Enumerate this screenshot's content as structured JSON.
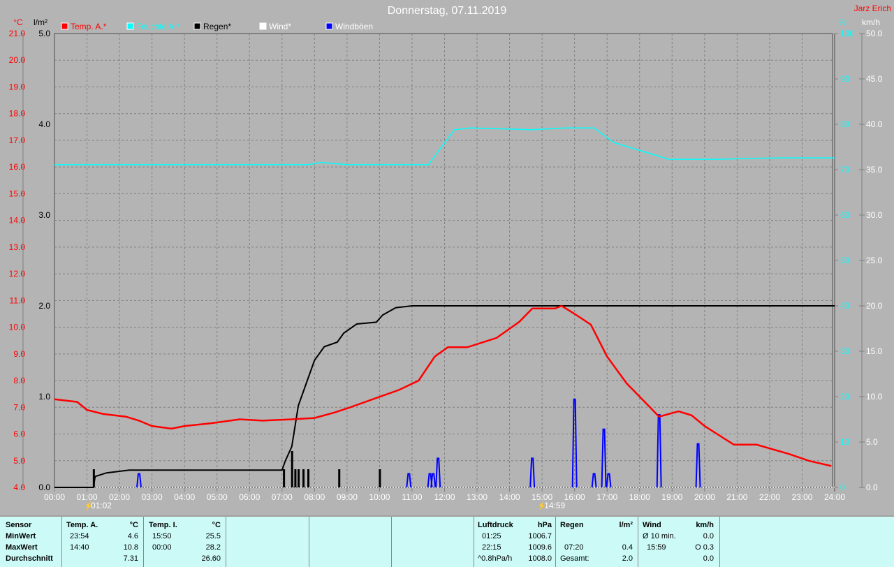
{
  "header": {
    "title": "Donnerstag, 07.11.2019",
    "author": "Jarz Erich"
  },
  "colors": {
    "temp": "#ff0000",
    "humidity": "#00ffff",
    "rain": "#000000",
    "wind": "#ffffff",
    "gusts": "#0000ff",
    "background": "#b4b4b4",
    "table": "#ccfaf7"
  },
  "chart_data": {
    "type": "line",
    "title": "Donnerstag, 07.11.2019",
    "legend": [
      "Temp. A.*",
      "Feuchte A.*",
      "Regen*",
      "Wind*",
      "Windböen"
    ],
    "legend_placement": "top",
    "grid": true,
    "x_ticks": [
      "00:00",
      "01:00",
      "02:00",
      "03:00",
      "04:00",
      "05:00",
      "06:00",
      "07:00",
      "08:00",
      "09:00",
      "10:00",
      "11:00",
      "12:00",
      "13:00",
      "14:00",
      "15:00",
      "16:00",
      "17:00",
      "18:00",
      "19:00",
      "20:00",
      "21:00",
      "22:00",
      "23:00",
      "24:00"
    ],
    "xlim": [
      0,
      24
    ],
    "axes": {
      "temp": {
        "unit": "°C",
        "ylim": [
          4,
          21
        ],
        "ticks": [
          "4.0",
          "5.0",
          "6.0",
          "7.0",
          "8.0",
          "9.0",
          "10.0",
          "11.0",
          "12.0",
          "13.0",
          "14.0",
          "15.0",
          "16.0",
          "17.0",
          "18.0",
          "19.0",
          "20.0",
          "21.0"
        ]
      },
      "rain": {
        "unit": "l/m²",
        "ylim": [
          0,
          5
        ],
        "ticks": [
          "0.0",
          "1.0",
          "2.0",
          "3.0",
          "4.0",
          "5.0"
        ]
      },
      "humidity": {
        "unit": "%",
        "ylim": [
          0,
          100
        ],
        "ticks": [
          "0",
          "10",
          "20",
          "30",
          "40",
          "50",
          "60",
          "70",
          "80",
          "90",
          "100"
        ]
      },
      "wind": {
        "unit": "km/h",
        "ylim": [
          0,
          50
        ],
        "ticks": [
          "0.0",
          "5.0",
          "10.0",
          "15.0",
          "20.0",
          "25.0",
          "30.0",
          "35.0",
          "40.0",
          "45.0",
          "50.0"
        ]
      }
    },
    "series": [
      {
        "name": "Temp. A.*",
        "axis": "temp",
        "x": [
          0,
          0.7,
          1,
          1.5,
          2.2,
          2.6,
          3,
          3.6,
          4,
          4.8,
          5.7,
          6.4,
          7.3,
          8,
          8.6,
          9.1,
          9.9,
          10.6,
          11.2,
          11.7,
          12.1,
          12.7,
          13.6,
          14.3,
          14.7,
          15.4,
          15.6,
          16,
          16.5,
          17,
          17.6,
          18.2,
          18.6,
          19.2,
          19.6,
          20,
          20.9,
          21.6,
          22.6,
          23.2,
          23.9
        ],
        "y": [
          7.3,
          7.2,
          6.9,
          6.75,
          6.65,
          6.5,
          6.3,
          6.2,
          6.3,
          6.4,
          6.55,
          6.5,
          6.55,
          6.6,
          6.8,
          7.0,
          7.35,
          7.65,
          8.0,
          8.9,
          9.25,
          9.25,
          9.6,
          10.2,
          10.7,
          10.7,
          10.8,
          10.5,
          10.1,
          8.9,
          7.9,
          7.15,
          6.65,
          6.85,
          6.7,
          6.3,
          5.6,
          5.6,
          5.25,
          5.0,
          4.8
        ]
      },
      {
        "name": "Feuchte A.*",
        "axis": "humidity",
        "x": [
          0,
          7.8,
          8.2,
          9,
          11.5,
          12.3,
          12.8,
          14.7,
          15.7,
          16.6,
          17.2,
          18.9,
          20.4,
          21.5,
          22.5,
          24
        ],
        "y": [
          71.1,
          71.1,
          71.6,
          71.1,
          71.1,
          78.8,
          79.2,
          78.8,
          79.2,
          79.2,
          76,
          72.3,
          72.3,
          72.5,
          72.6,
          72.6
        ]
      },
      {
        "name": "Regen*",
        "axis": "rain",
        "x": [
          0,
          1.2,
          1.25,
          1.6,
          2.3,
          7.0,
          7.1,
          7.3,
          7.5,
          7.8,
          8.0,
          8.3,
          8.7,
          8.9,
          9.3,
          9.9,
          10.1,
          10.5,
          11.0,
          24
        ],
        "y": [
          0,
          0,
          0.12,
          0.16,
          0.19,
          0.19,
          0.29,
          0.45,
          0.9,
          1.2,
          1.4,
          1.55,
          1.6,
          1.7,
          1.8,
          1.82,
          1.9,
          1.98,
          2.0,
          2.0
        ]
      },
      {
        "name": "Regen bars",
        "axis": "rain",
        "x": [
          1.2,
          7.05,
          7.3,
          7.4,
          7.5,
          7.65,
          7.8,
          8.75,
          10.0
        ],
        "y": [
          0.2,
          0.2,
          0.4,
          0.2,
          0.2,
          0.2,
          0.2,
          0.2,
          0.2
        ]
      },
      {
        "name": "Wind*",
        "axis": "wind",
        "x": [
          0,
          24
        ],
        "y": [
          0,
          0
        ]
      },
      {
        "name": "Windböen",
        "axis": "wind",
        "x": [
          2.6,
          10.9,
          11.55,
          11.65,
          11.8,
          14.7,
          16.0,
          16.6,
          16.9,
          17.05,
          18.6,
          19.8
        ],
        "y": [
          1.5,
          1.5,
          1.5,
          1.5,
          3.2,
          3.2,
          9.7,
          1.5,
          6.4,
          1.5,
          8.0,
          4.8
        ]
      }
    ],
    "annotations": [
      {
        "x": 1.03,
        "label": "01:02"
      },
      {
        "x": 14.98,
        "label": "14:59"
      }
    ]
  },
  "stats": {
    "rows": [
      "Sensor",
      "MinWert",
      "MaxWert",
      "Durchschnitt"
    ],
    "temp_a": {
      "header": "Temp. A.",
      "unit": "°C",
      "min_time": "23:54",
      "min": "4.6",
      "max_time": "14:40",
      "max": "10.8",
      "avg": "7.31"
    },
    "temp_i": {
      "header": "Temp. I.",
      "unit": "°C",
      "min_time": "15:50",
      "min": "25.5",
      "max_time": "00:00",
      "max": "28.2",
      "avg": "26.60"
    },
    "pressure": {
      "header": "Luftdruck",
      "unit": "hPa",
      "min_time": "01:25",
      "min": "1006.7",
      "max_time": "22:15",
      "max": "1009.6",
      "trend": "^0.8hPa/h",
      "avg": "1008.0"
    },
    "rain": {
      "header": "Regen",
      "unit": "l/m²",
      "max_time": "07:20",
      "max": "0.4",
      "total_label": "Gesamt:",
      "total": "2.0"
    },
    "wind": {
      "header": "Wind",
      "unit": "km/h",
      "avg_label": "Ø 10 min.",
      "avg": "0.0",
      "max_time": "15:59",
      "max": "O 0.3",
      "last": "0.0"
    }
  }
}
